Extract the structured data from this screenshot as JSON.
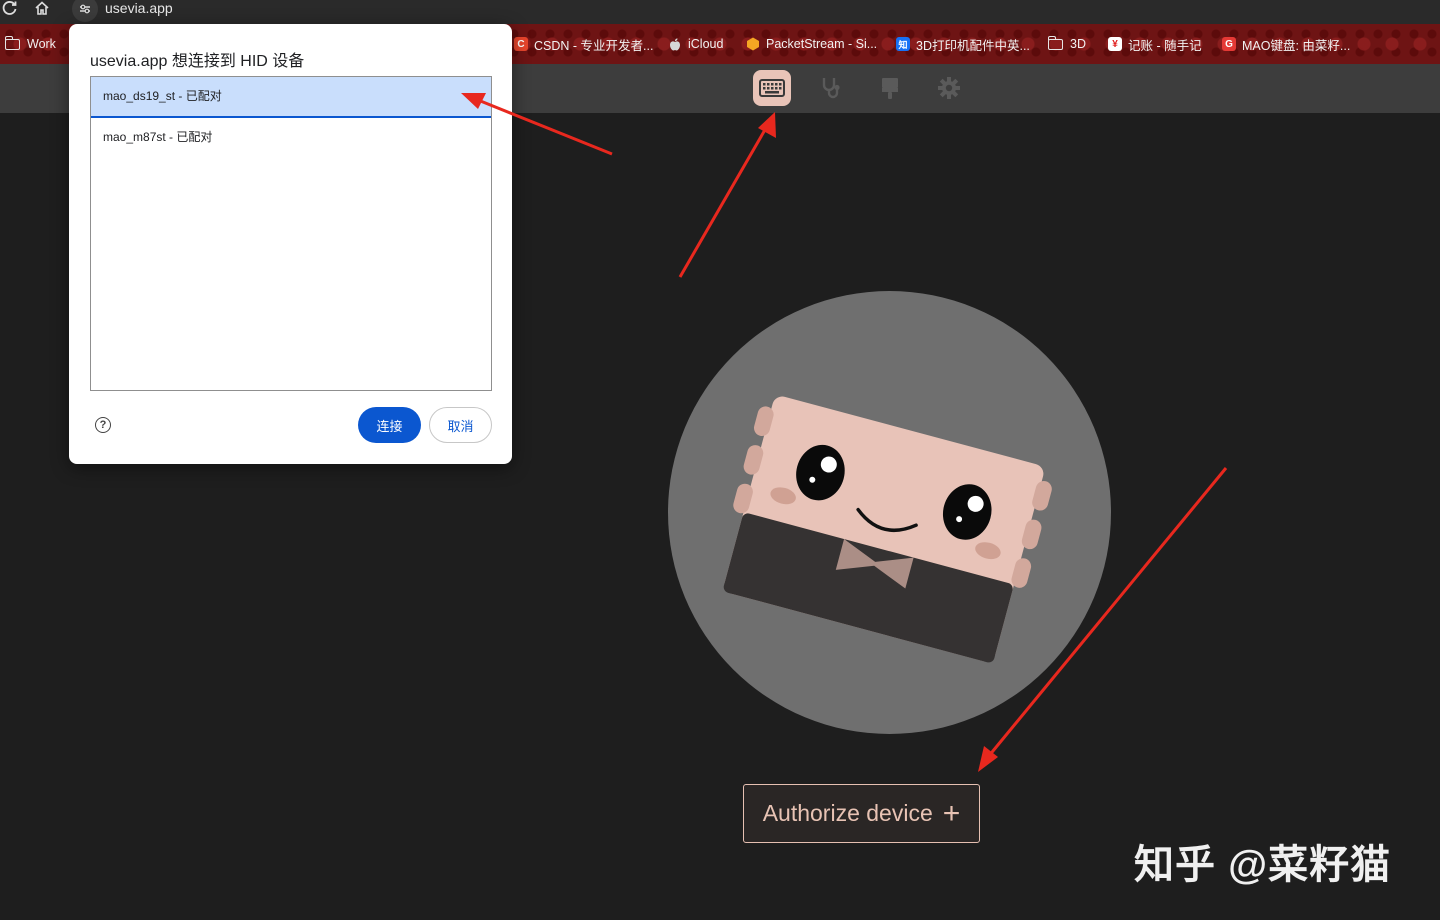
{
  "browser": {
    "url": "usevia.app",
    "bookmarks": [
      {
        "label": "Work",
        "icon": "folder-icon"
      },
      {
        "label": "CSDN - 专业开发者...",
        "icon": "csdn-icon",
        "color": "#e8452c"
      },
      {
        "label": "iCloud",
        "icon": "apple-icon"
      },
      {
        "label": "PacketStream - Si...",
        "icon": "packetstream-icon",
        "color": "#f5a623"
      },
      {
        "label": "3D打印机配件中英...",
        "icon": "zhihu-icon",
        "color": "#1772f6"
      },
      {
        "label": "3D",
        "icon": "folder-icon"
      },
      {
        "label": "记账 - 随手记",
        "icon": "yen-icon",
        "color": "#e02020"
      },
      {
        "label": "MAO键盘: 由菜籽...",
        "icon": "g-icon",
        "color": "#e53935"
      }
    ],
    "icon_glyphs": {
      "csdn": "C",
      "zhihu": "知",
      "yen": "¥",
      "g": "G"
    }
  },
  "app": {
    "header_icons": [
      "keyboard-icon",
      "stethoscope-icon",
      "brush-icon",
      "gear-icon"
    ],
    "active_icon": "keyboard-icon",
    "accent_color": "#e9c4b8",
    "authorize_label": "Authorize device",
    "authorize_plus": "+"
  },
  "dialog": {
    "title": "usevia.app 想连接到 HID 设备",
    "devices": [
      {
        "label": "mao_ds19_st - 已配对",
        "selected": true
      },
      {
        "label": "mao_m87st - 已配对",
        "selected": false
      }
    ],
    "help_glyph": "?",
    "connect_label": "连接",
    "cancel_label": "取消"
  },
  "watermark": "知乎 @菜籽猫"
}
